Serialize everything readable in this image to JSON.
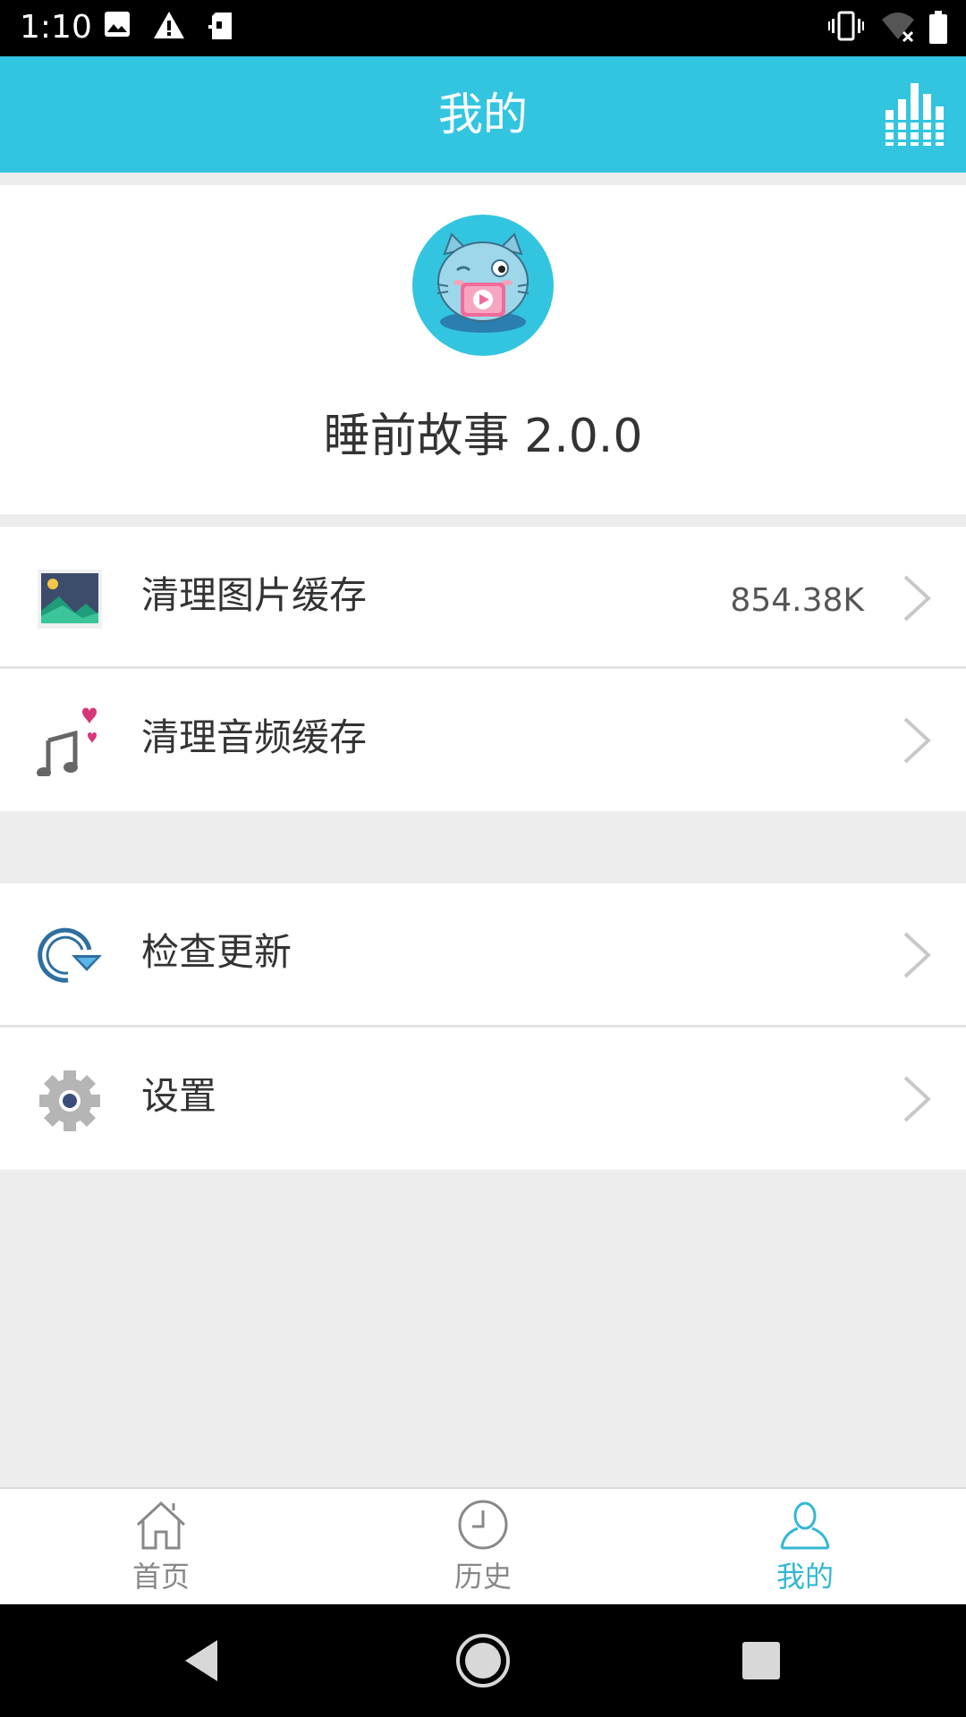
{
  "status_bar": {
    "time": "1:10",
    "icons": [
      "image-icon",
      "warning-icon",
      "sim-icon",
      "vibrate-icon",
      "wifi-off-icon",
      "battery-icon"
    ]
  },
  "header": {
    "title": "我的",
    "action_icon": "equalizer-icon"
  },
  "profile": {
    "avatar_icon": "cat-mascot-icon",
    "app_name": "睡前故事 2.0.0"
  },
  "menu": {
    "clear_image_cache": {
      "label": "清理图片缓存",
      "value": "854.38K",
      "icon": "picture-icon"
    },
    "clear_audio_cache": {
      "label": "清理音频缓存",
      "icon": "music-hearts-icon"
    },
    "check_update": {
      "label": "检查更新",
      "icon": "refresh-icon"
    },
    "settings": {
      "label": "设置",
      "icon": "gear-icon"
    }
  },
  "bottom_nav": {
    "tabs": [
      {
        "label": "首页",
        "icon": "home-icon"
      },
      {
        "label": "历史",
        "icon": "clock-icon"
      },
      {
        "label": "我的",
        "icon": "user-icon",
        "active": true
      }
    ]
  },
  "colors": {
    "accent": "#33c5e0",
    "active_tab": "#33b7d4",
    "background": "#ededed"
  }
}
